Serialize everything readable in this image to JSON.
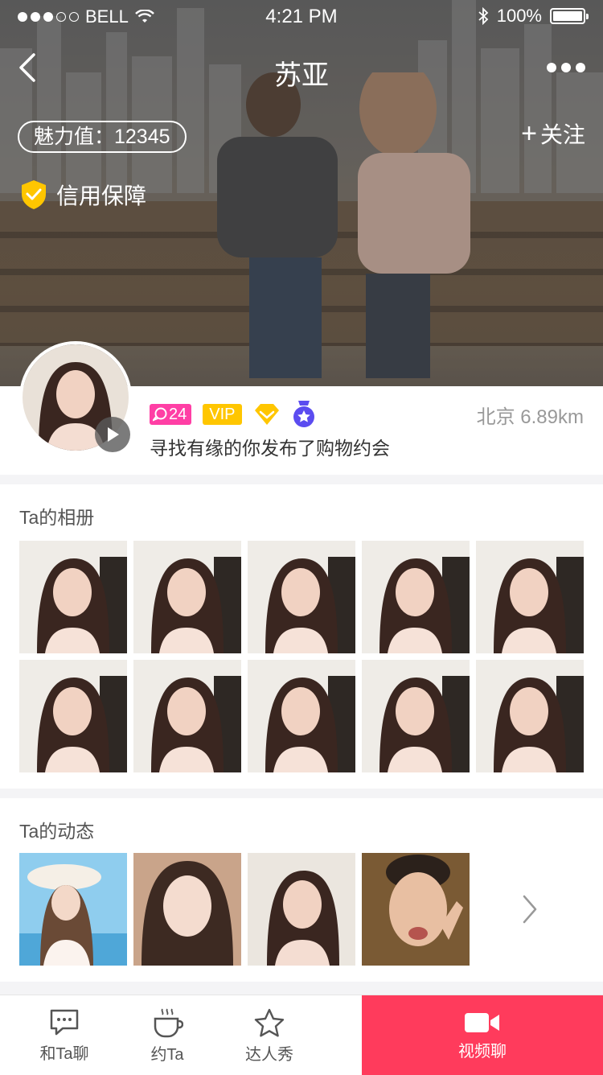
{
  "status_bar": {
    "carrier": "BELL",
    "time": "4:21 PM",
    "battery": "100%"
  },
  "nav": {
    "title": "苏亚"
  },
  "hero": {
    "charm_label": "魅力值：12345",
    "follow_label": "关注",
    "credit_label": "信用保障"
  },
  "profile": {
    "chat_count": "24",
    "vip_label": "VIP",
    "location": "北京 6.89km",
    "signature": "寻找有缘的你发布了购物约会"
  },
  "album": {
    "title": "Ta的相册",
    "count_shown": 10
  },
  "moments": {
    "title": "Ta的动态",
    "count_shown": 4
  },
  "tabbar": {
    "items": [
      {
        "label": "和Ta聊",
        "icon": "chat-bubble-icon"
      },
      {
        "label": "约Ta",
        "icon": "coffee-cup-icon"
      },
      {
        "label": "达人秀",
        "icon": "star-icon"
      },
      {
        "label": "视频聊",
        "icon": "video-camera-icon"
      }
    ]
  },
  "colors": {
    "accent": "#ff3b5c",
    "vip": "#ffc600",
    "chat_badge": "#ff3fa5",
    "medal": "#5b4cf0",
    "shield": "#ffc600"
  }
}
